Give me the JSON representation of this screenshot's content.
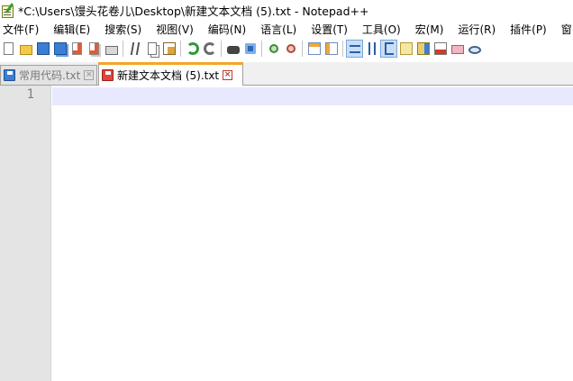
{
  "window": {
    "title": "*C:\\Users\\馒头花卷儿\\Desktop\\新建文本文档 (5).txt - Notepad++",
    "app_icon": "notepad-plus-plus-icon"
  },
  "menu": {
    "items": [
      {
        "label": "文件(F)"
      },
      {
        "label": "编辑(E)"
      },
      {
        "label": "搜索(S)"
      },
      {
        "label": "视图(V)"
      },
      {
        "label": "编码(N)"
      },
      {
        "label": "语言(L)"
      },
      {
        "label": "设置(T)"
      },
      {
        "label": "工具(O)"
      },
      {
        "label": "宏(M)"
      },
      {
        "label": "运行(R)"
      },
      {
        "label": "插件(P)"
      },
      {
        "label": "窗口(W)"
      }
    ]
  },
  "toolbar": {
    "icons": [
      "new-file-icon",
      "open-file-icon",
      "save-icon",
      "save-all-icon",
      "close-icon",
      "close-all-icon",
      "print-icon",
      "cut-icon",
      "copy-icon",
      "paste-icon",
      "undo-icon",
      "redo-icon",
      "find-icon",
      "replace-icon",
      "zoom-in-icon",
      "zoom-out-icon",
      "sync-vertical-icon",
      "sync-horizontal-icon",
      "word-wrap-icon",
      "show-all-characters-icon",
      "indent-guide-icon",
      "user-defined-language-icon",
      "document-map-icon",
      "function-list-icon",
      "folder-as-workspace-icon",
      "monitoring-icon"
    ],
    "active": [
      "word-wrap-icon",
      "indent-guide-icon"
    ]
  },
  "tabs": [
    {
      "label": "常用代码.txt",
      "active": false,
      "icon_color": "#3a7fd6"
    },
    {
      "label": "新建文本文档 (5).txt",
      "active": true,
      "icon_color": "#e2433a"
    }
  ],
  "editor": {
    "line_numbers": [
      "1"
    ],
    "current_line_color": "#e8e8ff",
    "gutter_color": "#e4e4e4"
  }
}
